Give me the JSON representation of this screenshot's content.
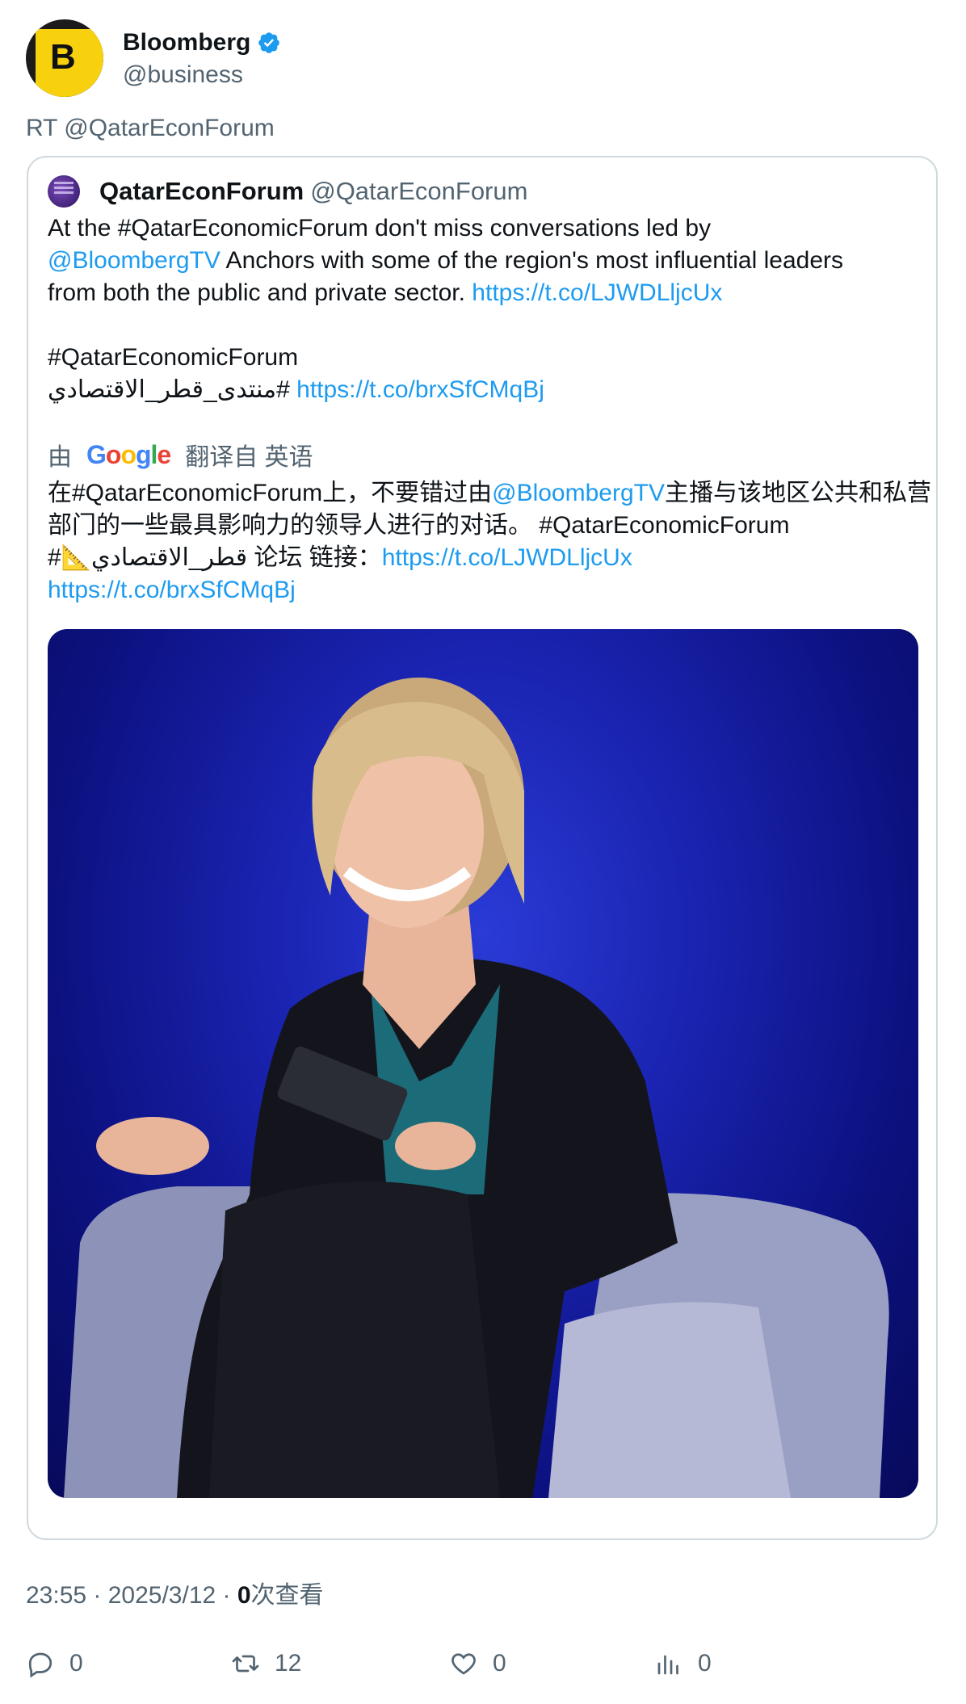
{
  "author": {
    "name": "Bloomberg",
    "handle": "@business",
    "avatar_letter": "B",
    "verified_icon": "verified-badge-icon"
  },
  "retweet_label": "RT @QatarEconForum",
  "quoted": {
    "name": "QatarEconForum",
    "handle": "@QatarEconForum",
    "text_line1_pre": "At the #QatarEconomicForum don't miss conversations led by",
    "mention": "@BloombergTV",
    "text_line2_post": " Anchors with some of the region's most influential leaders",
    "text_line3_pre": "from both the public and private sector. ",
    "link1": "https://t.co/LJWDLljcUx",
    "hashtag1": "#QatarEconomicForum",
    "hashtag2": "#منتدى_قطر_الاقتصادي",
    "link2": "https://t.co/brxSfCMqBj"
  },
  "translation": {
    "prefix": "由",
    "google": "Google",
    "suffix": "翻译自 英语",
    "cn_pre": "在#QatarEconomicForum上，不要错过由",
    "cn_mention": "@BloombergTV",
    "cn_mid": "主播与该地区公共和私营部门的一些最具影响力的领导人进行的对话。 #QatarEconomicForum",
    "cn_arabic": "#📐قطر_الاقتصادي 论坛 链接：",
    "cn_link1": "https://t.co/LJWDLljcUx",
    "cn_link2": "https://t.co/brxSfCMqBj"
  },
  "meta": {
    "time": "23:55 · 2025/3/12 · ",
    "views_count": "0",
    "views_label": "次查看"
  },
  "actions": {
    "replies": "0",
    "retweets": "12",
    "likes": "0",
    "views": "0"
  },
  "colors": {
    "link": "#1d9bf0",
    "secondary_text": "#536471",
    "border": "#cfd9de",
    "bloomberg_yellow": "#f7d10e"
  }
}
